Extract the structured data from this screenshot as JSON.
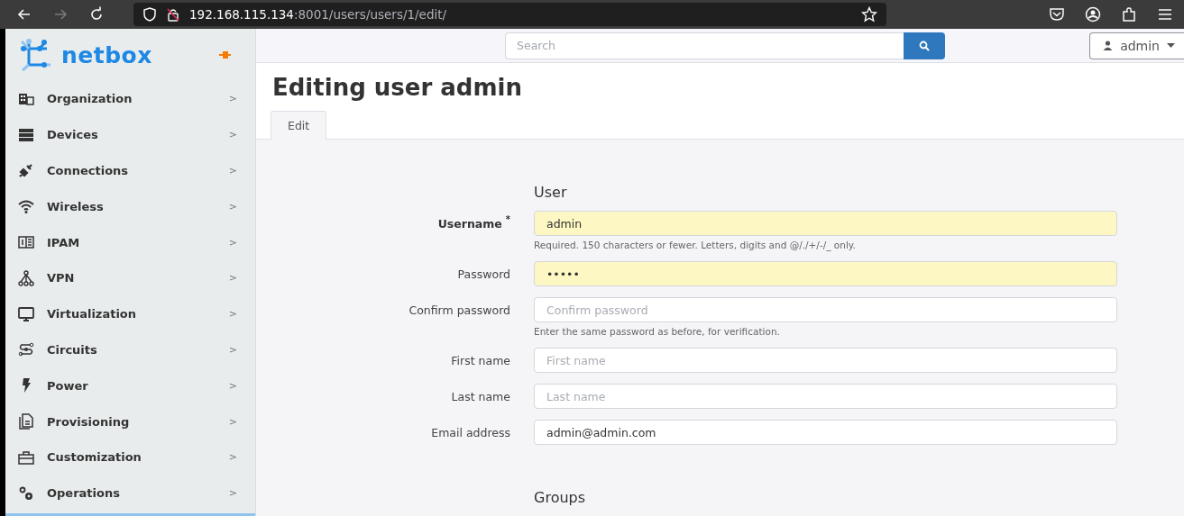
{
  "browser": {
    "url_host": "192.168.115.134",
    "url_path": ":8001/users/users/1/edit/",
    "forward_disabled": true
  },
  "sidebar": {
    "brand": "netbox",
    "items": [
      {
        "label": "Organization",
        "chevron": ">"
      },
      {
        "label": "Devices",
        "chevron": ">"
      },
      {
        "label": "Connections",
        "chevron": ">"
      },
      {
        "label": "Wireless",
        "chevron": ">"
      },
      {
        "label": "IPAM",
        "chevron": ">"
      },
      {
        "label": "VPN",
        "chevron": ">"
      },
      {
        "label": "Virtualization",
        "chevron": ">"
      },
      {
        "label": "Circuits",
        "chevron": ">"
      },
      {
        "label": "Power",
        "chevron": ">"
      },
      {
        "label": "Provisioning",
        "chevron": ">"
      },
      {
        "label": "Customization",
        "chevron": ">"
      },
      {
        "label": "Operations",
        "chevron": ">"
      }
    ]
  },
  "header": {
    "search": {
      "placeholder": "Search"
    },
    "user": "admin"
  },
  "page": {
    "title": "Editing user admin",
    "tabs": [
      {
        "label": "Edit",
        "selected": true
      }
    ]
  },
  "form": {
    "sections": [
      {
        "title": "User",
        "fields": [
          {
            "label": "Username",
            "required_mark": "*",
            "value": "admin",
            "autofilled": true,
            "help": "Required. 150 characters or fewer. Letters, digits and @/./+/-/_ only."
          },
          {
            "label": "Password",
            "value": "•••••",
            "autofilled": true
          },
          {
            "label": "Confirm password",
            "placeholder": "Confirm password",
            "autofilled": false,
            "help": "Enter the same password as before, for verification."
          },
          {
            "label": "First name",
            "placeholder": "First name",
            "autofilled": false
          },
          {
            "label": "Last name",
            "placeholder": "Last name",
            "autofilled": false
          },
          {
            "label": "Email address",
            "value": "admin@admin.com",
            "autofilled": false
          }
        ]
      },
      {
        "title": "Groups"
      }
    ]
  }
}
